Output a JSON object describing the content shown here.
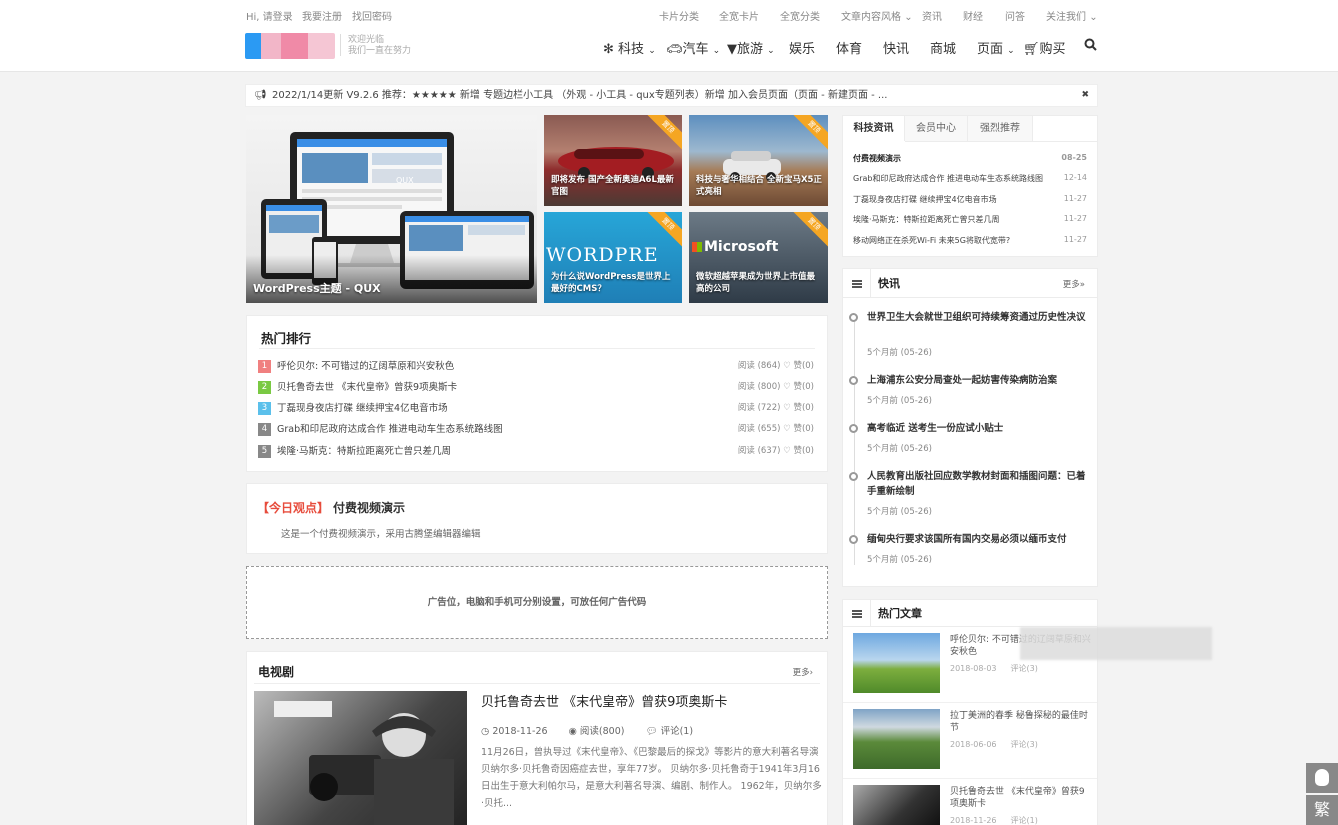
{
  "topbar": {
    "left_links": [
      "Hi, 请登录",
      "我要注册",
      "找回密码"
    ],
    "right_links": [
      "卡片分类",
      "全宽卡片",
      "全宽分类",
      "文章内容风格",
      "资讯",
      "财经",
      "问答",
      "关注我们"
    ],
    "logo_text": [
      "欢迎光临",
      "我们一直在努力"
    ],
    "nav": [
      "科技",
      "汽车",
      "旅游",
      "娱乐",
      "体育",
      "快讯",
      "商城",
      "页面",
      "购买"
    ]
  },
  "notice": {
    "text": "2022/1/14更新 V9.2.6 推荐：★★★★★ 新增 专题边栏小工具 （外观 - 小工具 - qux专题列表）新增 加入会员页面（页面 - 新建页面 - ...",
    "close": "✖"
  },
  "slider": {
    "main_caption": "WordPress主题 - QUX",
    "tiles": [
      {
        "caption": "即将发布 国产全新奥迪A6L最新官图",
        "badge": "置顶"
      },
      {
        "caption": "科技与奢华相结合 全新宝马X5正式亮相",
        "badge": "置顶"
      },
      {
        "caption": "为什么说WordPress是世界上最好的CMS？",
        "badge": "置顶",
        "logo": "WORDPRE"
      },
      {
        "caption": "微软超越苹果成为世界上市值最高的公司",
        "badge": "置顶",
        "logo": "Microsoft"
      }
    ]
  },
  "hot_rank": {
    "title": "热门排行",
    "rows": [
      {
        "num": "1",
        "title": "呼伦贝尔: 不可错过的辽阔草原和兴安秋色",
        "meta": "阅读 (864)  ♡ 赞(0)"
      },
      {
        "num": "2",
        "title": "贝托鲁奇去世 《末代皇帝》曾获9项奥斯卡",
        "meta": "阅读 (800)  ♡ 赞(0)"
      },
      {
        "num": "3",
        "title": "丁磊现身夜店打碟 继续押宝4亿电音市场",
        "meta": "阅读 (722)  ♡ 赞(0)"
      },
      {
        "num": "4",
        "title": "Grab和印尼政府达成合作 推进电动车生态系统路线图",
        "meta": "阅读 (655)  ♡ 赞(0)"
      },
      {
        "num": "5",
        "title": "埃隆·马斯克：特斯拉距离死亡曾只差几周",
        "meta": "阅读 (637)  ♡ 赞(0)"
      }
    ],
    "colors": [
      "#f08080",
      "#7ac943",
      "#5bc0eb",
      "#888888",
      "#888888"
    ]
  },
  "today": {
    "tag": "【今日观点】",
    "title": "付费视频演示",
    "desc": "这是一个付费视频演示，采用古腾堡编辑器编辑"
  },
  "ad": {
    "text": "广告位，电脑和手机可分别设置，可放任何广告代码"
  },
  "tv": {
    "title": "电视剧",
    "more": "更多›",
    "article_title": "贝托鲁奇去世 《末代皇帝》曾获9项奥斯卡",
    "date": "2018-11-26",
    "views": "阅读(800)",
    "comments": "评论(1)",
    "excerpt": "11月26日，曾执导过《末代皇帝》、《巴黎最后的探戈》等影片的意大利著名导演贝纳尔多·贝托鲁奇因癌症去世，享年77岁。 贝纳尔多·贝托鲁奇于1941年3月16日出生于意大利帕尔马，是意大利著名导演、编剧、制作人。 1962年，贝纳尔多·贝托..."
  },
  "side_tabs": [
    "科技资讯",
    "会员中心",
    "强烈推荐"
  ],
  "side_list": [
    {
      "title": "付费视频演示",
      "date": "08-25"
    },
    {
      "title": "Grab和印尼政府达成合作 推进电动车生态系统路线图",
      "date": "12-14"
    },
    {
      "title": "丁磊现身夜店打碟 继续押宝4亿电音市场",
      "date": "11-27"
    },
    {
      "title": "埃隆·马斯克：特斯拉距离死亡曾只差几周",
      "date": "11-27"
    },
    {
      "title": "移动网络正在杀死Wi-Fi 未来5G将取代宽带?",
      "date": "11-27"
    }
  ],
  "flash": {
    "title": "快讯",
    "more": "更多»",
    "items": [
      {
        "title": "世界卫生大会就世卫组织可持续筹资通过历史性决议",
        "time": "5个月前 (05-26)"
      },
      {
        "title": "上海浦东公安分局查处一起妨害传染病防治案",
        "time": "5个月前 (05-26)"
      },
      {
        "title": "高考临近 送考生一份应试小贴士",
        "time": "5个月前 (05-26)"
      },
      {
        "title": "人民教育出版社回应数学教材封面和插图问题：已着手重新绘制",
        "time": "5个月前 (05-26)"
      },
      {
        "title": "缅甸央行要求该国所有国内交易必须以缅币支付",
        "time": "5个月前 (05-26)"
      }
    ]
  },
  "hot_articles": {
    "title": "热门文章",
    "items": [
      {
        "title": "呼伦贝尔: 不可错过的辽阔草原和兴安秋色",
        "date": "2018-08-03",
        "comments": "评论(3)"
      },
      {
        "title": "拉丁美洲的春季 秘鲁探秘的最佳时节",
        "date": "2018-06-06",
        "comments": "评论(3)"
      },
      {
        "title": "贝托鲁奇去世 《末代皇帝》曾获9项奥斯卡",
        "date": "2018-11-26",
        "comments": "评论(1)"
      }
    ]
  },
  "floating": {
    "traditional": "繁"
  },
  "icons": [
    "bullhorn-icon",
    "close-icon",
    "fan-icon",
    "car-icon",
    "filter-icon",
    "cart-icon",
    "search-icon",
    "chevron-down-icon",
    "clock-icon",
    "eye-icon",
    "comment-icon",
    "menu-icon",
    "qq-icon"
  ]
}
